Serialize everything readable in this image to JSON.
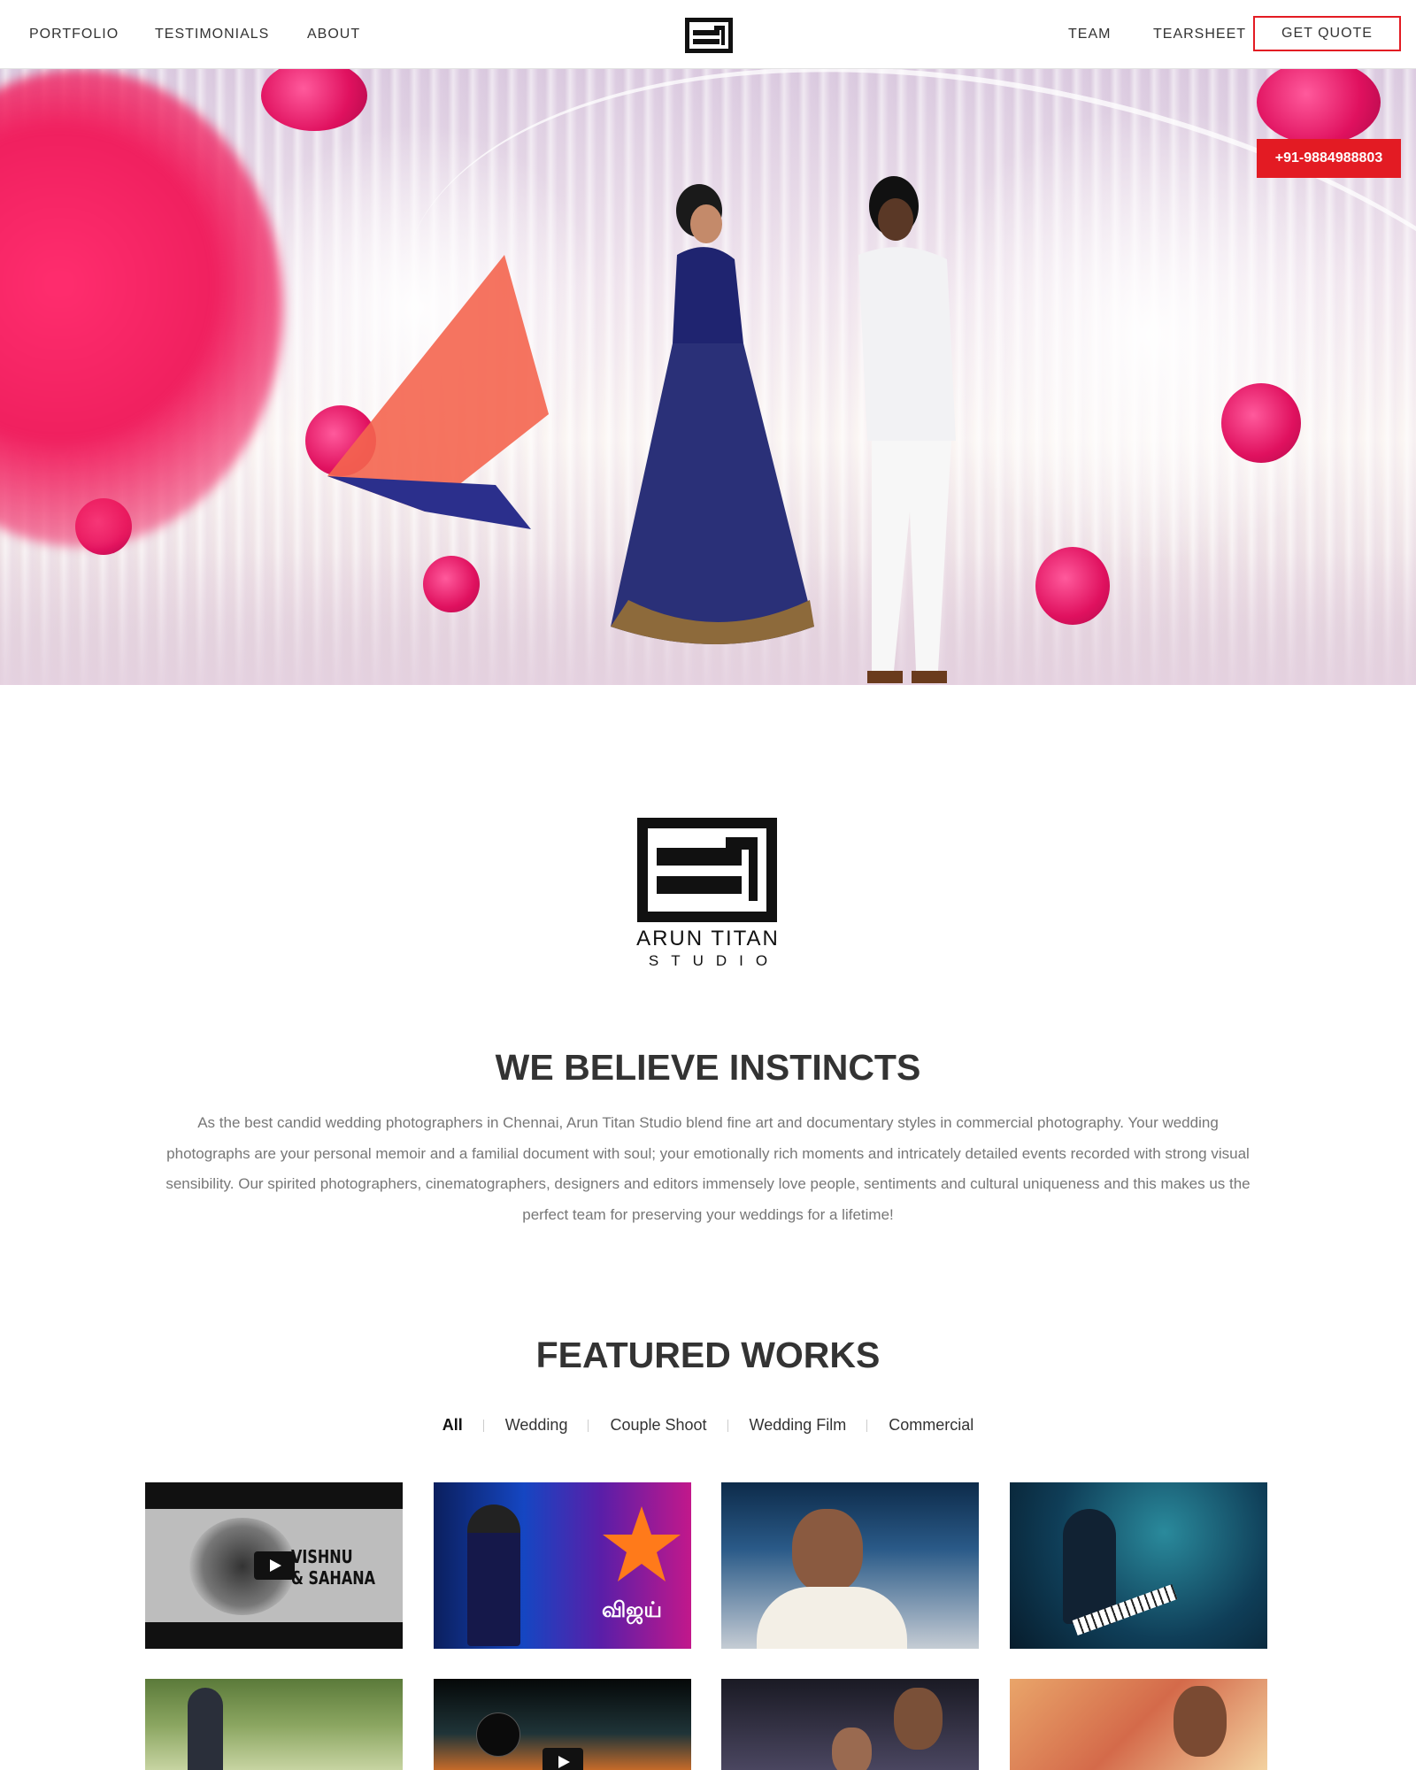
{
  "header": {
    "nav_left": [
      "PORTFOLIO",
      "TESTIMONIALS",
      "ABOUT"
    ],
    "nav_right": [
      "TEAM",
      "TEARSHEET"
    ],
    "quote_label": "GET QUOTE"
  },
  "hero": {
    "phone": "+91-9884988803"
  },
  "about": {
    "brand_name": "ARUN TITAN",
    "brand_sub": "STUDIO",
    "title": "WE BELIEVE INSTINCTS",
    "text": "As the best candid wedding photographers in Chennai, Arun Titan Studio blend fine art and documentary styles in commercial photography. Your wedding photographs are your personal memoir and a familial document with soul; your emotionally rich moments and intricately detailed events recorded with strong visual sensibility. Our spirited photographers, cinematographers, designers and editors immensely love people, sentiments and cultural uniqueness and this makes us the perfect team for preserving your weddings for a lifetime!"
  },
  "featured": {
    "title": "FEATURED WORKS",
    "filters": [
      "All",
      "Wedding",
      "Couple Shoot",
      "Wedding Film",
      "Commercial"
    ],
    "active_filter": "All",
    "thumb_caption": "VISHNU\n& SAHANA",
    "star_caption": "விஜய்"
  },
  "colors": {
    "accent": "#e31b23",
    "text": "#333333",
    "muted": "#777777"
  }
}
